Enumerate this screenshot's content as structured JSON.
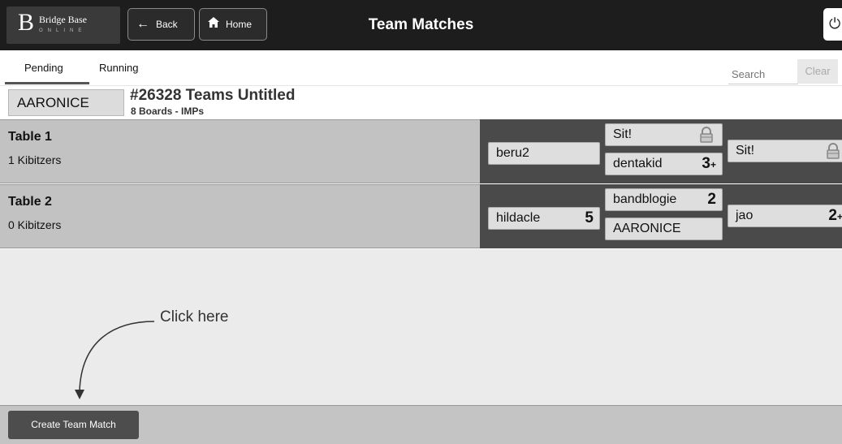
{
  "header": {
    "logo_letter": "B",
    "logo_name": "Bridge Base",
    "logo_sub": "ONLINE",
    "back_label": "Back",
    "home_label": "Home",
    "title": "Team Matches"
  },
  "tabs": [
    {
      "label": "Pending",
      "active": true
    },
    {
      "label": "Running",
      "active": false
    }
  ],
  "search": {
    "placeholder": "Search",
    "clear_label": "Clear"
  },
  "match": {
    "host": "AARONICE",
    "title": "#26328 Teams Untitled",
    "subtitle": "8 Boards - IMPs"
  },
  "tables": [
    {
      "name": "Table 1",
      "kibitzers": "1 Kibitzers",
      "west": {
        "name": "beru2",
        "badge": "",
        "badge_plus": ""
      },
      "north": {
        "name": "Sit!",
        "locked": true
      },
      "south": {
        "name": "dentakid",
        "badge": "3",
        "badge_plus": "+"
      },
      "east": {
        "name": "Sit!",
        "locked": true
      }
    },
    {
      "name": "Table 2",
      "kibitzers": "0 Kibitzers",
      "west": {
        "name": "hildacle",
        "badge": "5",
        "badge_plus": ""
      },
      "north": {
        "name": "bandblogie",
        "badge": "2",
        "badge_plus": ""
      },
      "south": {
        "name": "AARONICE",
        "badge": "",
        "badge_plus": ""
      },
      "east": {
        "name": "jao",
        "badge": "2",
        "badge_plus": "+"
      }
    }
  ],
  "hint": "Click here",
  "footer": {
    "create_label": "Create Team Match"
  },
  "colors": {
    "topbar": "#1d1d1d",
    "row": "#c2c2c2",
    "seats_bg": "#4a4a4a"
  }
}
